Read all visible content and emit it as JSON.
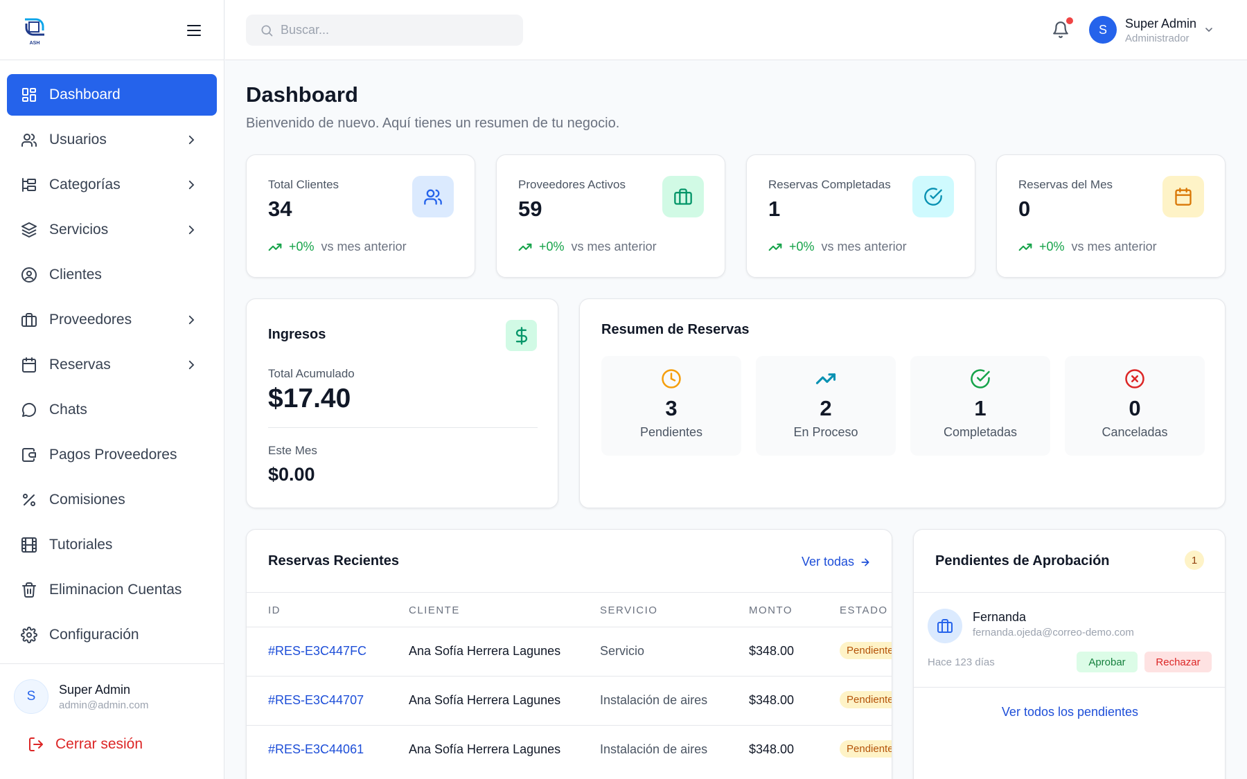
{
  "brand": {
    "logo_text": "ASH"
  },
  "sidebar": {
    "items": [
      {
        "label": "Dashboard"
      },
      {
        "label": "Usuarios"
      },
      {
        "label": "Categorías"
      },
      {
        "label": "Servicios"
      },
      {
        "label": "Clientes"
      },
      {
        "label": "Proveedores"
      },
      {
        "label": "Reservas"
      },
      {
        "label": "Chats"
      },
      {
        "label": "Pagos Proveedores"
      },
      {
        "label": "Comisiones"
      },
      {
        "label": "Tutoriales"
      },
      {
        "label": "Eliminacion Cuentas"
      },
      {
        "label": "Configuración"
      }
    ],
    "user": {
      "initial": "S",
      "name": "Super Admin",
      "email": "admin@admin.com"
    },
    "logout_label": "Cerrar sesión"
  },
  "header": {
    "search_placeholder": "Buscar...",
    "user": {
      "initial": "S",
      "name": "Super Admin",
      "role": "Administrador"
    }
  },
  "page": {
    "title": "Dashboard",
    "subtitle": "Bienvenido de nuevo. Aquí tienes un resumen de tu negocio."
  },
  "stats": [
    {
      "label": "Total Clientes",
      "value": "34",
      "trend": "+0%",
      "trend_text": "vs mes anterior"
    },
    {
      "label": "Proveedores Activos",
      "value": "59",
      "trend": "+0%",
      "trend_text": "vs mes anterior"
    },
    {
      "label": "Reservas Completadas",
      "value": "1",
      "trend": "+0%",
      "trend_text": "vs mes anterior"
    },
    {
      "label": "Reservas del Mes",
      "value": "0",
      "trend": "+0%",
      "trend_text": "vs mes anterior"
    }
  ],
  "ingresos": {
    "title": "Ingresos",
    "total_label": "Total Acumulado",
    "total_value": "$17.40",
    "month_label": "Este Mes",
    "month_value": "$0.00"
  },
  "resumen": {
    "title": "Resumen de Reservas",
    "items": [
      {
        "value": "3",
        "label": "Pendientes"
      },
      {
        "value": "2",
        "label": "En Proceso"
      },
      {
        "value": "1",
        "label": "Completadas"
      },
      {
        "value": "0",
        "label": "Canceladas"
      }
    ]
  },
  "recientes": {
    "title": "Reservas Recientes",
    "view_all": "Ver todas",
    "columns": [
      "ID",
      "CLIENTE",
      "SERVICIO",
      "MONTO",
      "ESTADO"
    ],
    "rows": [
      {
        "id": "#RES-E3C447FC",
        "cliente": "Ana Sofía Herrera Lagunes",
        "servicio": "Servicio",
        "monto": "$348.00",
        "estado": "Pendiente"
      },
      {
        "id": "#RES-E3C44707",
        "cliente": "Ana Sofía Herrera Lagunes",
        "servicio": "Instalación de aires",
        "monto": "$348.00",
        "estado": "Pendiente"
      },
      {
        "id": "#RES-E3C44061",
        "cliente": "Ana Sofía Herrera Lagunes",
        "servicio": "Instalación de aires",
        "monto": "$348.00",
        "estado": "Pendiente"
      }
    ]
  },
  "pendientes": {
    "title": "Pendientes de Aprobación",
    "count": "1",
    "item": {
      "name": "Fernanda",
      "email": "fernanda.ojeda@correo-demo.com",
      "time": "Hace 123 días",
      "approve": "Aprobar",
      "reject": "Rechazar"
    },
    "view_all": "Ver todos los pendientes"
  },
  "colors": {
    "primary": "#2563eb",
    "success": "#16a34a",
    "danger": "#dc2626",
    "warning": "#d97706"
  }
}
